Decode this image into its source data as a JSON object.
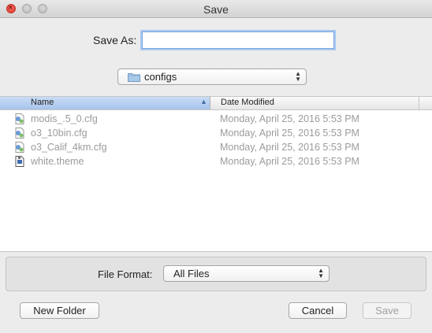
{
  "window": {
    "title": "Save"
  },
  "save_as": {
    "label": "Save As:",
    "value": ""
  },
  "location": {
    "folder_name": "configs",
    "icon": "folder-icon"
  },
  "columns": {
    "name": "Name",
    "date_modified": "Date Modified",
    "sort": "ascending"
  },
  "files": [
    {
      "name": "modis_.5_0.cfg",
      "date": "Monday, April 25, 2016 5:53 PM",
      "icon": "cfg-file-icon"
    },
    {
      "name": "o3_10bin.cfg",
      "date": "Monday, April 25, 2016 5:53 PM",
      "icon": "cfg-file-icon"
    },
    {
      "name": "o3_Calif_4km.cfg",
      "date": "Monday, April 25, 2016 5:53 PM",
      "icon": "cfg-file-icon"
    },
    {
      "name": "white.theme",
      "date": "Monday, April 25, 2016 5:53 PM",
      "icon": "theme-file-icon"
    }
  ],
  "file_format": {
    "label": "File Format:",
    "value": "All Files"
  },
  "buttons": {
    "new_folder": "New Folder",
    "cancel": "Cancel",
    "save": "Save"
  }
}
